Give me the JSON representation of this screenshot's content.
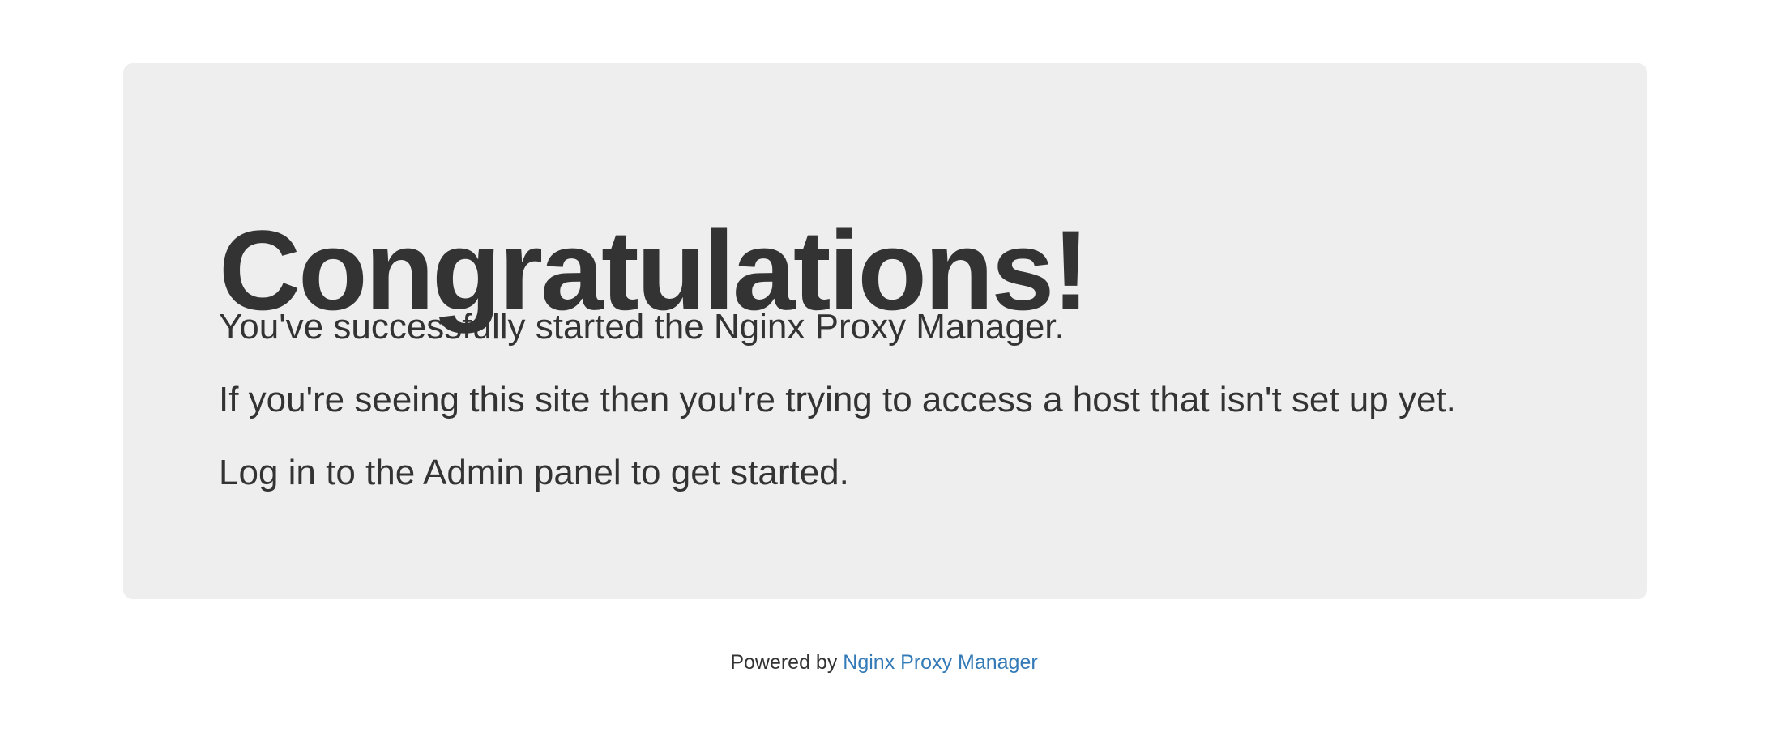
{
  "jumbotron": {
    "headline": "Congratulations!",
    "lines": [
      "You've successfully started the Nginx Proxy Manager.",
      "If you're seeing this site then you're trying to access a host that isn't set up yet.",
      "Log in to the Admin panel to get started."
    ]
  },
  "footer": {
    "prefix": "Powered by",
    "link_label": "Nginx Proxy Manager"
  },
  "colors": {
    "panel_background": "#eeeeee",
    "text": "#333333",
    "link": "#337ab7"
  }
}
